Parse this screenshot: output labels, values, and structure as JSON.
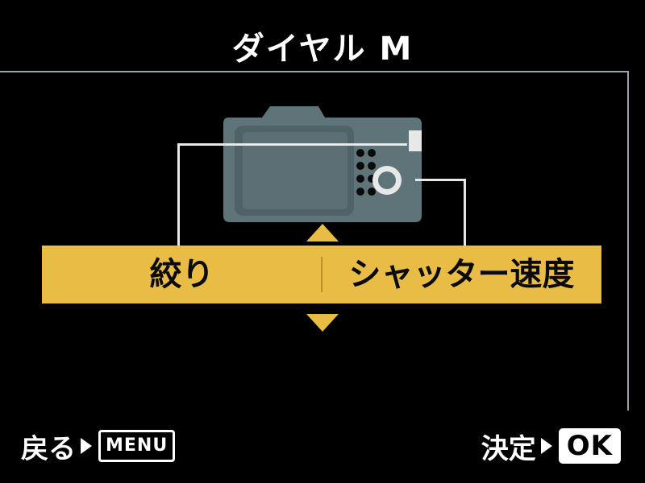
{
  "header": {
    "title": "ダイヤル M"
  },
  "selector": {
    "left_label": "絞り",
    "right_label": "シャッター速度"
  },
  "footer": {
    "back_label": "戻る",
    "menu_button": "MENU",
    "confirm_label": "決定",
    "ok_button": "OK"
  },
  "colors": {
    "accent": "#e9bd45",
    "camera_body": "#5f7479",
    "camera_screen": "#4a5c61"
  }
}
